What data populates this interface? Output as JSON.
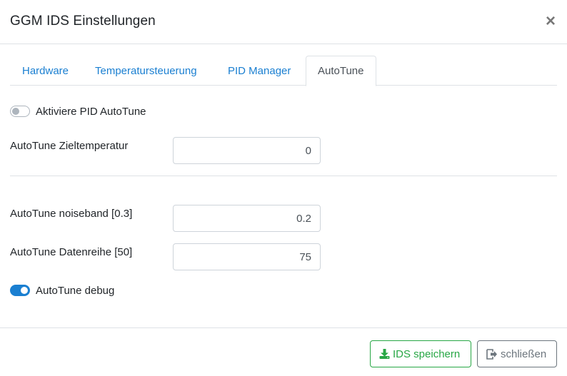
{
  "modal": {
    "title": "GGM IDS Einstellungen",
    "close_symbol": "×"
  },
  "tabs": [
    {
      "label": "Hardware",
      "active": false
    },
    {
      "label": "Temperatursteuerung",
      "active": false
    },
    {
      "label": "PID Manager",
      "active": false
    },
    {
      "label": "AutoTune",
      "active": true
    }
  ],
  "autotune": {
    "enable_label": "Aktiviere PID AutoTune",
    "enable_checked": false,
    "target_temp_label": "AutoTune Zieltemperatur",
    "target_temp_value": "0",
    "noiseband_label": "AutoTune noiseband [0.3]",
    "noiseband_value": "0.2",
    "datarow_label": "AutoTune Datenreihe [50]",
    "datarow_value": "75",
    "debug_label": "AutoTune debug",
    "debug_checked": true
  },
  "footer": {
    "save_label": "IDS speichern",
    "save_icon": "download-icon",
    "close_label": "schließen",
    "close_icon": "sign-out-icon"
  },
  "colors": {
    "link": "#1a7fd1",
    "switch_on": "#1a7fd1",
    "save_button": "#28a745",
    "close_button": "#6c757d"
  }
}
